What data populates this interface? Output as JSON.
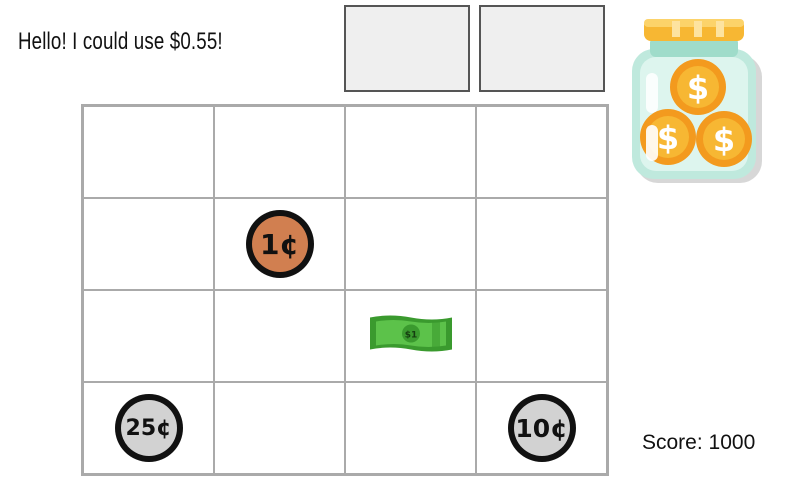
{
  "prompt": {
    "text": "Hello! I could use $0.55!"
  },
  "slots": [
    {
      "content": ""
    },
    {
      "content": ""
    }
  ],
  "grid": {
    "rows": 4,
    "cols": 4,
    "items": [
      {
        "type": "coin",
        "label": "1¢",
        "row": 2,
        "col": 2,
        "color": "#d17f50"
      },
      {
        "type": "bill",
        "label": "$1",
        "row": 3,
        "col": 3,
        "color": "#4caf3a"
      },
      {
        "type": "coin",
        "label": "25¢",
        "row": 4,
        "col": 1,
        "color": "#d2d2d2"
      },
      {
        "type": "coin",
        "label": "10¢",
        "row": 4,
        "col": 4,
        "color": "#d2d2d2"
      }
    ]
  },
  "jar": {
    "icon": "money-jar-icon"
  },
  "score": {
    "label": "Score:",
    "value": "1000"
  }
}
